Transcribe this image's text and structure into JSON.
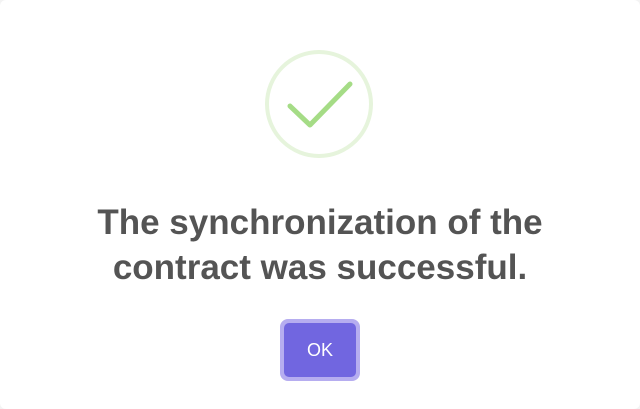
{
  "dialog": {
    "icon": "success-check-icon",
    "title_line1": "The synchronization of the",
    "title_line2": "contract was successful.",
    "confirm_label": "OK"
  },
  "colors": {
    "check": "#a5dc86",
    "check_ring": "#e6f4dc",
    "confirm_button": "#7166e0",
    "confirm_button_focus_ring": "#b6adf0",
    "title_text": "#545454"
  }
}
